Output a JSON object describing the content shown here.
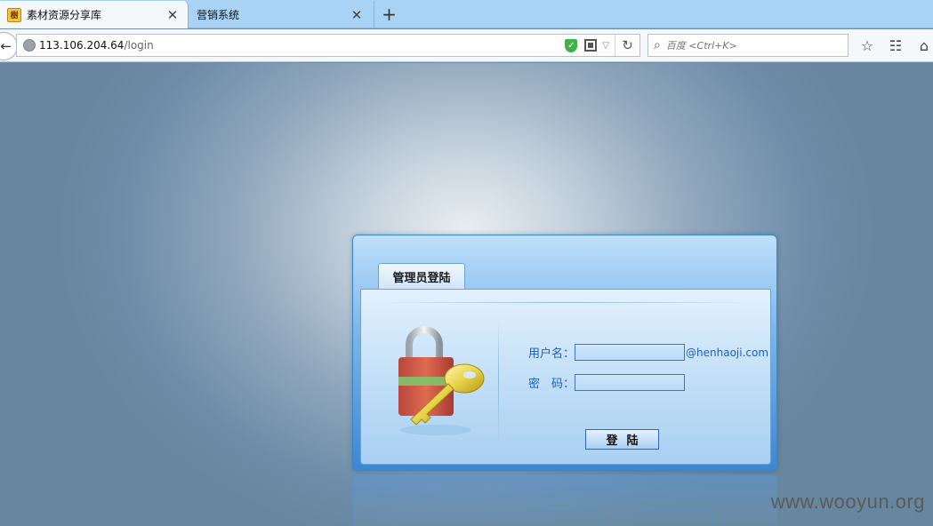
{
  "browser": {
    "tabs": [
      {
        "title": "素材资源分享库",
        "favicon": "site-favicon",
        "active": true
      },
      {
        "title": "营销系统",
        "active": false
      }
    ],
    "new_tab_symbol": "+",
    "close_symbol": "✕",
    "url_host": "113.106.204.64",
    "url_path": "/login",
    "search_placeholder": "百度 <Ctrl+K>",
    "icons": [
      "back-icon",
      "globe-icon",
      "shield-icon",
      "qr-code-icon",
      "dropdown-icon",
      "reload-icon",
      "search-icon",
      "bookmark-star-icon",
      "reading-list-icon",
      "home-icon"
    ]
  },
  "login": {
    "tab_title": "管理员登陆",
    "username_label": "用户名：",
    "username_value": "",
    "domain_suffix": "@henhaoji.com",
    "password_label": "密　码：",
    "password_value": "",
    "submit_label": "登陆"
  },
  "watermark": "www.wooyun.org",
  "colors": {
    "page_background": "#6f8ea9",
    "panel_blue": "#7cb7ea",
    "label_blue": "#1c5fb8"
  }
}
